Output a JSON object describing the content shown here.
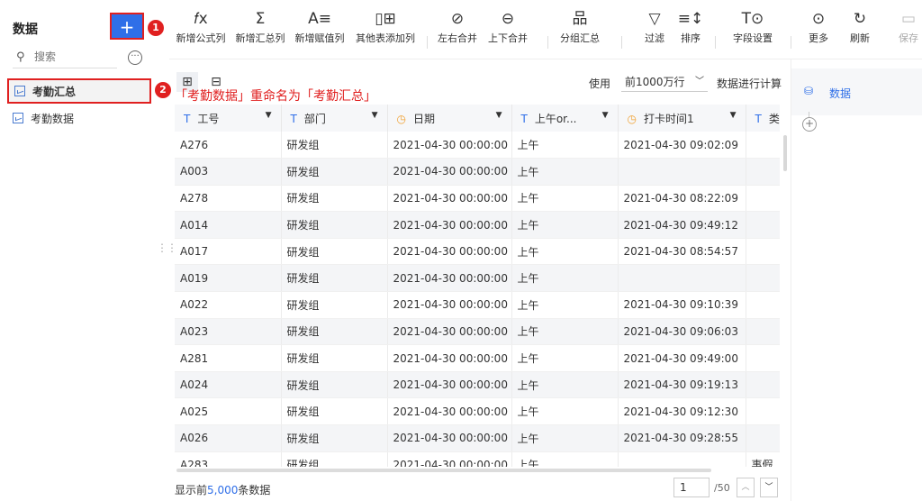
{
  "sidebar": {
    "title": "数据",
    "add_label": "+",
    "search_placeholder": "搜索",
    "more_label": "···",
    "items": [
      {
        "label": "考勤汇总",
        "active": true
      },
      {
        "label": "考勤数据",
        "active": false
      }
    ]
  },
  "badges": {
    "one": "1",
    "two": "2"
  },
  "toolbar": {
    "items": [
      {
        "icon": "fx-icon",
        "glyph": "𝑓x",
        "label": "新增公式列"
      },
      {
        "icon": "sigma-icon",
        "glyph": "Σ",
        "label": "新增汇总列"
      },
      {
        "icon": "assign-icon",
        "glyph": "A≡",
        "label": "新增赋值列"
      },
      {
        "icon": "add-column-icon",
        "glyph": "▯⊞",
        "label": "其他表添加列"
      },
      {
        "icon": "left-right-merge-icon",
        "glyph": "⊘",
        "label": "左右合并"
      },
      {
        "icon": "up-down-merge-icon",
        "glyph": "⊖",
        "label": "上下合并"
      },
      {
        "icon": "group-summary-icon",
        "glyph": "品",
        "label": "分组汇总"
      },
      {
        "icon": "filter-icon",
        "glyph": "▽",
        "label": "过滤"
      },
      {
        "icon": "sort-icon",
        "glyph": "≡↕",
        "label": "排序"
      },
      {
        "icon": "field-settings-icon",
        "glyph": "T⊙",
        "label": "字段设置"
      },
      {
        "icon": "more-icon",
        "glyph": "⊙",
        "label": "更多"
      },
      {
        "icon": "refresh-icon",
        "glyph": "↻",
        "label": "刷新"
      },
      {
        "icon": "save-icon",
        "glyph": "▭",
        "label": "保存"
      }
    ]
  },
  "annotation": "「考勤数据」重命名为「考勤汇总」",
  "options": {
    "use_label": "使用",
    "rows_option": "前1000万行",
    "compute_label": "数据进行计算"
  },
  "table": {
    "columns": [
      {
        "type": "T",
        "label": "工号"
      },
      {
        "type": "T",
        "label": "部门"
      },
      {
        "type": "clock",
        "label": "日期"
      },
      {
        "type": "T",
        "label": "上午or..."
      },
      {
        "type": "clock",
        "label": "打卡时间1"
      },
      {
        "type": "T",
        "label": "类"
      }
    ],
    "rows": [
      [
        "A276",
        "研发组",
        "2021-04-30 00:00:00",
        "上午",
        "2021-04-30 09:02:09",
        ""
      ],
      [
        "A003",
        "研发组",
        "2021-04-30 00:00:00",
        "上午",
        "",
        ""
      ],
      [
        "A278",
        "研发组",
        "2021-04-30 00:00:00",
        "上午",
        "2021-04-30 08:22:09",
        ""
      ],
      [
        "A014",
        "研发组",
        "2021-04-30 00:00:00",
        "上午",
        "2021-04-30 09:49:12",
        ""
      ],
      [
        "A017",
        "研发组",
        "2021-04-30 00:00:00",
        "上午",
        "2021-04-30 08:54:57",
        ""
      ],
      [
        "A019",
        "研发组",
        "2021-04-30 00:00:00",
        "上午",
        "",
        ""
      ],
      [
        "A022",
        "研发组",
        "2021-04-30 00:00:00",
        "上午",
        "2021-04-30 09:10:39",
        ""
      ],
      [
        "A023",
        "研发组",
        "2021-04-30 00:00:00",
        "上午",
        "2021-04-30 09:06:03",
        ""
      ],
      [
        "A281",
        "研发组",
        "2021-04-30 00:00:00",
        "上午",
        "2021-04-30 09:49:00",
        ""
      ],
      [
        "A024",
        "研发组",
        "2021-04-30 00:00:00",
        "上午",
        "2021-04-30 09:19:13",
        ""
      ],
      [
        "A025",
        "研发组",
        "2021-04-30 00:00:00",
        "上午",
        "2021-04-30 09:12:30",
        ""
      ],
      [
        "A026",
        "研发组",
        "2021-04-30 00:00:00",
        "上午",
        "2021-04-30 09:28:55",
        ""
      ],
      [
        "A283",
        "研发组",
        "2021-04-30 00:00:00",
        "上午",
        "",
        "事假"
      ]
    ]
  },
  "footer": {
    "prefix": "显示前",
    "count": "5,000",
    "suffix": "条数据",
    "page": "1",
    "total": "/50"
  },
  "right_panel": {
    "label": "数据",
    "add": "+"
  }
}
